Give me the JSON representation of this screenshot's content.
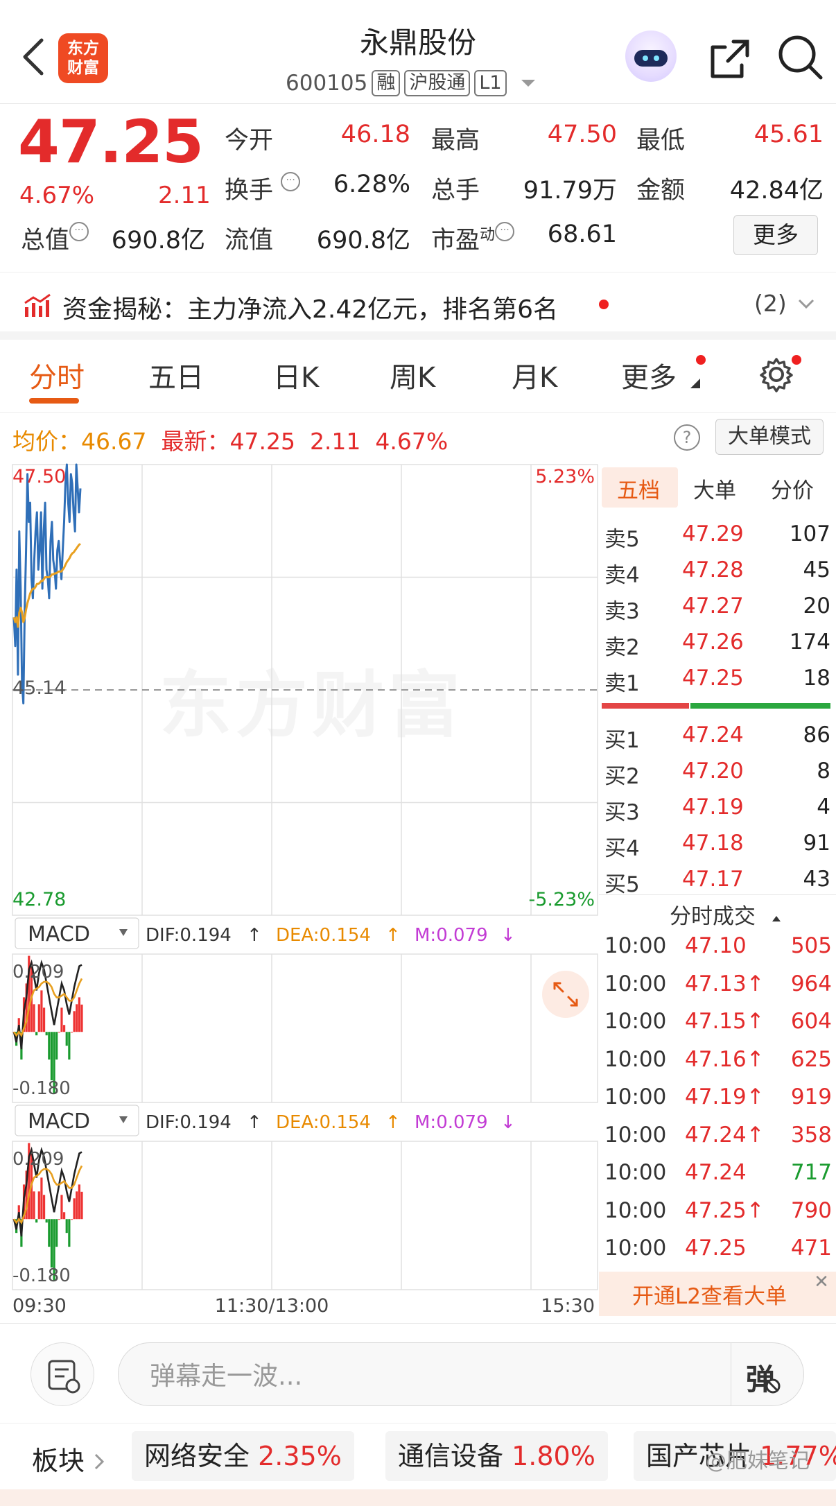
{
  "header": {
    "logo_line1": "东方",
    "logo_line2": "财富",
    "stock_name": "永鼎股份",
    "stock_code": "600105",
    "tags": [
      "融",
      "沪股通",
      "L1"
    ]
  },
  "quote": {
    "price": "47.25",
    "change_pct": "4.67%",
    "change": "2.11",
    "fields": [
      {
        "label": "今开",
        "value": "46.18",
        "color": "red"
      },
      {
        "label": "最高",
        "value": "47.50",
        "color": "red"
      },
      {
        "label": "最低",
        "value": "45.61",
        "color": "red"
      },
      {
        "label": "换手",
        "value": "6.28%",
        "color": "dark"
      },
      {
        "label": "总手",
        "value": "91.79万",
        "color": "dark"
      },
      {
        "label": "金额",
        "value": "42.84亿",
        "color": "dark"
      },
      {
        "label": "总值",
        "value": "690.8亿",
        "color": "dark"
      },
      {
        "label": "流值",
        "value": "690.8亿",
        "color": "dark"
      },
      {
        "label": "市盈",
        "label_sup": "动",
        "value": "68.61",
        "color": "dark"
      }
    ],
    "more_label": "更多"
  },
  "fund_flow": {
    "text": "资金揭秘：主力净流入2.42亿元，排名第6名",
    "count": "(2)"
  },
  "tabs": [
    "分时",
    "五日",
    "日K",
    "周K",
    "月K",
    "更多"
  ],
  "avg_line": {
    "avg_label": "均价：",
    "avg_value": "46.67",
    "latest_label": "最新：",
    "latest_value": "47.25",
    "latest_change": "2.11",
    "latest_pct": "4.67%"
  },
  "big_order_mode_label": "大单模式",
  "watermark": "东方财富",
  "chart_data": {
    "type": "line",
    "y_top_label": "47.50",
    "y_mid_label": "45.14",
    "y_bottom_label": "42.78",
    "pct_top_label": "5.23%",
    "pct_bottom_label": "-5.23%",
    "ylim": [
      42.78,
      47.5
    ],
    "prev_close": 45.14,
    "x_labels": [
      "09:30",
      "11:30/13:00",
      "15:30"
    ],
    "series": [
      {
        "color": "#2f6fb8",
        "values": [
          45.9,
          45.6,
          46.4,
          45.3,
          46.8,
          46.2,
          45.2,
          45.0,
          46.0,
          46.6,
          47.4,
          46.9,
          47.1,
          46.3,
          46.1,
          46.5,
          46.8,
          47.0,
          46.4,
          46.6,
          47.0,
          46.2,
          46.8,
          47.1,
          46.4,
          46.3,
          46.1,
          46.7,
          46.9,
          46.5,
          46.4,
          46.2,
          46.6,
          46.7,
          46.5,
          46.3,
          46.6,
          46.9,
          47.3,
          47.5,
          47.1,
          46.9,
          47.4,
          47.3,
          47.0,
          46.8,
          47.5,
          47.25,
          47.0,
          47.25
        ]
      },
      {
        "color": "#e8a020",
        "values": [
          45.9,
          45.85,
          45.9,
          45.8,
          45.95,
          46.0,
          45.95,
          45.85,
          45.9,
          45.98,
          46.05,
          46.1,
          46.15,
          46.18,
          46.2,
          46.2,
          46.22,
          46.25,
          46.25,
          46.26,
          46.28,
          46.28,
          46.3,
          46.32,
          46.32,
          46.32,
          46.32,
          46.33,
          46.35,
          46.35,
          46.36,
          46.36,
          46.37,
          46.38,
          46.38,
          46.38,
          46.4,
          46.42,
          46.45,
          46.48,
          46.5,
          46.52,
          46.55,
          46.57,
          46.58,
          46.6,
          46.62,
          46.64,
          46.66,
          46.67
        ]
      }
    ],
    "macd": {
      "label": "MACD",
      "dif": "DIF:0.194",
      "dea": "DEA:0.154",
      "m": "M:0.079",
      "top_label": "0.209",
      "bottom_label": "-0.180",
      "ylim": [
        -0.18,
        0.209
      ],
      "dif_series": [
        0.0,
        -0.03,
        0.02,
        -0.05,
        0.06,
        0.1,
        0.18,
        0.2,
        0.16,
        0.12,
        0.17,
        0.2,
        0.18,
        0.14,
        0.1,
        0.06,
        0.02,
        0.06,
        0.1,
        0.14,
        0.12,
        0.08,
        0.05,
        0.09,
        0.13,
        0.16,
        0.19,
        0.194
      ],
      "dea_series": [
        0.0,
        -0.01,
        0.0,
        -0.01,
        0.01,
        0.03,
        0.07,
        0.1,
        0.12,
        0.125,
        0.13,
        0.14,
        0.145,
        0.145,
        0.14,
        0.13,
        0.11,
        0.1,
        0.1,
        0.105,
        0.11,
        0.1,
        0.09,
        0.09,
        0.1,
        0.12,
        0.14,
        0.154
      ],
      "m_series": [
        0.0,
        -0.04,
        0.04,
        -0.08,
        0.1,
        0.14,
        0.22,
        0.2,
        0.08,
        -0.01,
        0.08,
        0.12,
        0.07,
        -0.01,
        -0.08,
        -0.14,
        -0.18,
        -0.08,
        0.0,
        0.07,
        0.02,
        -0.04,
        -0.08,
        0.0,
        0.06,
        0.08,
        0.1,
        0.079
      ]
    }
  },
  "right_panel": {
    "tabs": [
      "五档",
      "大单",
      "分价"
    ],
    "asks": [
      {
        "label": "卖5",
        "price": "47.29",
        "vol": "107"
      },
      {
        "label": "卖4",
        "price": "47.28",
        "vol": "45"
      },
      {
        "label": "卖3",
        "price": "47.27",
        "vol": "20"
      },
      {
        "label": "卖2",
        "price": "47.26",
        "vol": "174"
      },
      {
        "label": "卖1",
        "price": "47.25",
        "vol": "18"
      }
    ],
    "bids": [
      {
        "label": "买1",
        "price": "47.24",
        "vol": "86"
      },
      {
        "label": "买2",
        "price": "47.20",
        "vol": "8"
      },
      {
        "label": "买3",
        "price": "47.19",
        "vol": "4"
      },
      {
        "label": "买4",
        "price": "47.18",
        "vol": "91"
      },
      {
        "label": "买5",
        "price": "47.17",
        "vol": "43"
      }
    ],
    "ticks_title": "分时成交",
    "ticks": [
      {
        "time": "10:00",
        "price": "47.10",
        "vol": "505",
        "vol_color": "red"
      },
      {
        "time": "10:00",
        "price": "47.13↑",
        "vol": "964",
        "vol_color": "red"
      },
      {
        "time": "10:00",
        "price": "47.15↑",
        "vol": "604",
        "vol_color": "red"
      },
      {
        "time": "10:00",
        "price": "47.16↑",
        "vol": "625",
        "vol_color": "red"
      },
      {
        "time": "10:00",
        "price": "47.19↑",
        "vol": "919",
        "vol_color": "red"
      },
      {
        "time": "10:00",
        "price": "47.24↑",
        "vol": "358",
        "vol_color": "red"
      },
      {
        "time": "10:00",
        "price": "47.24",
        "vol": "717",
        "vol_color": "green"
      },
      {
        "time": "10:00",
        "price": "47.25↑",
        "vol": "790",
        "vol_color": "red"
      },
      {
        "time": "10:00",
        "price": "47.25",
        "vol": "471",
        "vol_color": "red"
      }
    ],
    "l2_banner": "开通L2查看大单"
  },
  "comment": {
    "placeholder": "弹幕走一波...",
    "send_label": "弹"
  },
  "sectors": {
    "label": "板块",
    "items": [
      {
        "name": "网络安全",
        "pct": "2.35%"
      },
      {
        "name": "通信设备",
        "pct": "1.80%"
      },
      {
        "name": "国产芯片",
        "pct": "1.77%"
      }
    ]
  },
  "watermark_credit": "@肥妹笔记"
}
